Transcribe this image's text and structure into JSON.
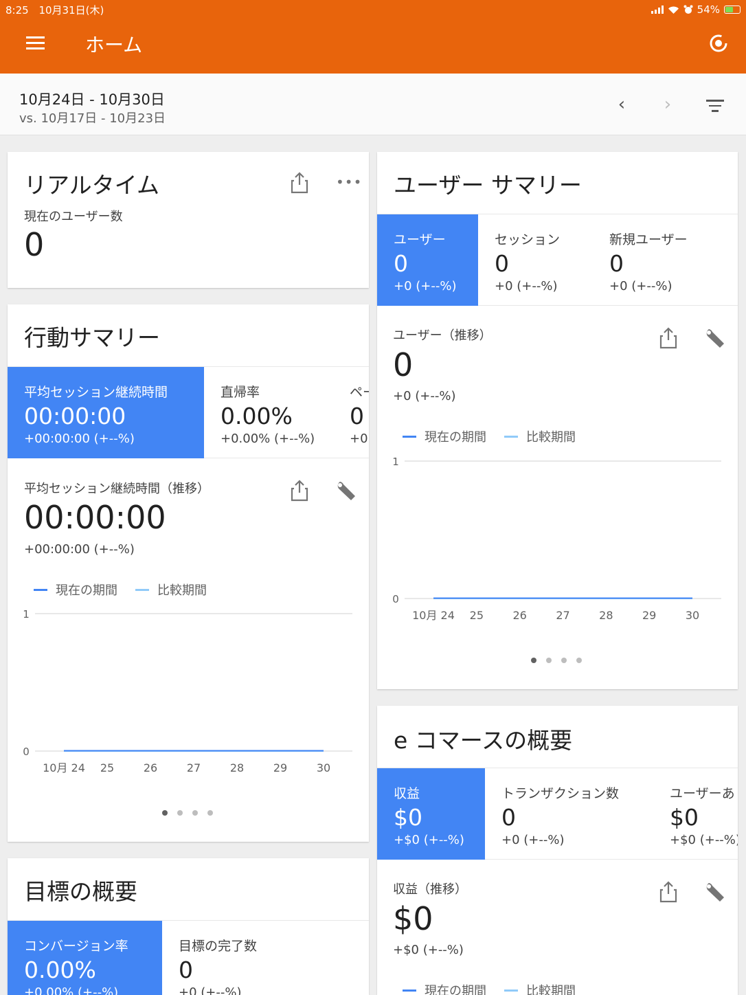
{
  "status": {
    "time": "8:25",
    "date": "10月31日(木)",
    "battery": "54%"
  },
  "appbar": {
    "title": "ホーム"
  },
  "daterange": {
    "current": "10月24日 - 10月30日",
    "compare": "vs. 10月17日 - 10月23日"
  },
  "realtime": {
    "title": "リアルタイム",
    "label": "現在のユーザー数",
    "value": "0",
    "more": "•••"
  },
  "behavior": {
    "title": "行動サマリー",
    "tabs": [
      {
        "label": "平均セッション継続時間",
        "value": "00:00:00",
        "delta": "+00:00:00 (+--%)"
      },
      {
        "label": "直帰率",
        "value": "0.00%",
        "delta": "+0.00% (+--%)"
      },
      {
        "label": "ペー",
        "value": "0",
        "delta": "+0 ("
      }
    ],
    "trend_label": "平均セッション継続時間（推移）",
    "trend_value": "00:00:00",
    "trend_delta": "+00:00:00 (+--%)"
  },
  "user_summary": {
    "title": "ユーザー サマリー",
    "tabs": [
      {
        "label": "ユーザー",
        "value": "0",
        "delta": "+0 (+--%)"
      },
      {
        "label": "セッション",
        "value": "0",
        "delta": "+0 (+--%)"
      },
      {
        "label": "新規ユーザー",
        "value": "0",
        "delta": "+0 (+--%)"
      }
    ],
    "trend_label": "ユーザー（推移）",
    "trend_value": "0",
    "trend_delta": "+0 (+--%)"
  },
  "goals": {
    "title": "目標の概要",
    "tabs": [
      {
        "label": "コンバージョン率",
        "value": "0.00%",
        "delta": "+0.00% (+--%)"
      },
      {
        "label": "目標の完了数",
        "value": "0",
        "delta": "+0 (+--%)"
      }
    ]
  },
  "ecommerce": {
    "title": "e コマースの概要",
    "tabs": [
      {
        "label": "収益",
        "value": "$0",
        "delta": "+$0 (+--%)"
      },
      {
        "label": "トランザクション数",
        "value": "0",
        "delta": "+0 (+--%)"
      },
      {
        "label": "ユーザーあ",
        "value": "$0",
        "delta": "+$0 (+--%)"
      }
    ],
    "trend_label": "収益（推移）",
    "trend_value": "$0",
    "trend_delta": "+$0 (+--%)"
  },
  "legend": {
    "current": "現在の期間",
    "compare": "比較期間"
  },
  "colors": {
    "appbar": "#e8640c",
    "selected_tab": "#4285f4",
    "current_series": "#4285f4",
    "compare_series": "#90caf9"
  },
  "chart_data": [
    {
      "type": "line",
      "x": [
        "10月 24",
        "25",
        "26",
        "27",
        "28",
        "29",
        "30"
      ],
      "series": [
        {
          "name": "現在の期間",
          "values": [
            0,
            0,
            0,
            0,
            0,
            0,
            0
          ]
        },
        {
          "name": "比較期間",
          "values": [
            0,
            0,
            0,
            0,
            0,
            0,
            0
          ]
        }
      ],
      "ylim": [
        0,
        1
      ],
      "yticks": [
        "0",
        "1"
      ]
    },
    {
      "type": "line",
      "x": [
        "10月 24",
        "25",
        "26",
        "27",
        "28",
        "29",
        "30"
      ],
      "series": [
        {
          "name": "現在の期間",
          "values": [
            0,
            0,
            0,
            0,
            0,
            0,
            0
          ]
        },
        {
          "name": "比較期間",
          "values": [
            0,
            0,
            0,
            0,
            0,
            0,
            0
          ]
        }
      ],
      "ylim": [
        0,
        1
      ],
      "yticks": [
        "0",
        "1"
      ]
    }
  ]
}
